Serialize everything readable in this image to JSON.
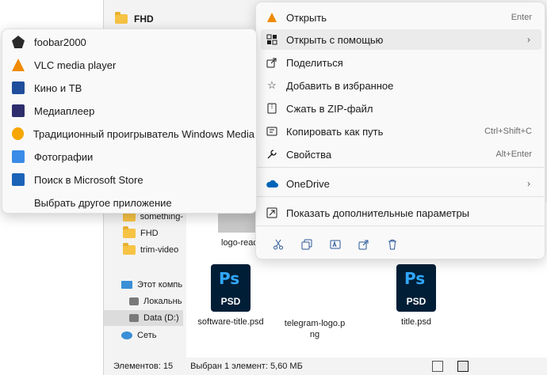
{
  "explorer": {
    "folder_title": "FHD",
    "nav_items": [
      {
        "label": "something-",
        "icon": "folder-icon"
      },
      {
        "label": "FHD",
        "icon": "folder-icon"
      },
      {
        "label": "trim-video",
        "icon": "folder-icon"
      },
      {
        "label": "Этот компь",
        "icon": "pc-icon"
      },
      {
        "label": "Локальнь",
        "icon": "drive-icon"
      },
      {
        "label": "Data (D:)",
        "icon": "drive-icon"
      },
      {
        "label": "Сеть",
        "icon": "network-icon"
      }
    ],
    "files": [
      {
        "name": "logo-ready",
        "type": "thumbnail"
      },
      {
        "name": "software-title.psd",
        "type": "psd"
      },
      {
        "name": "telegram-logo.p\nng",
        "type": "image"
      },
      {
        "name": "title.psd",
        "type": "psd"
      }
    ],
    "psd_icon": {
      "badge": "Ps",
      "ext": "PSD"
    },
    "status": {
      "count": "Элементов: 15",
      "selection": "Выбран 1 элемент: 5,60 МБ"
    }
  },
  "context_menu": {
    "items": [
      {
        "label": "Открыть",
        "shortcut": "Enter",
        "icon": "vlc-cone-icon"
      },
      {
        "label": "Открыть с помощью",
        "shortcut": "",
        "icon": "open-with-icon",
        "submenu": true
      },
      {
        "label": "Поделиться",
        "shortcut": "",
        "icon": "share-icon"
      },
      {
        "label": "Добавить в избранное",
        "shortcut": "",
        "icon": "star-icon"
      },
      {
        "label": "Сжать в ZIP-файл",
        "shortcut": "",
        "icon": "zip-icon"
      },
      {
        "label": "Копировать как путь",
        "shortcut": "Ctrl+Shift+C",
        "icon": "copy-path-icon"
      },
      {
        "label": "Свойства",
        "shortcut": "Alt+Enter",
        "icon": "wrench-icon"
      },
      {
        "label": "OneDrive",
        "shortcut": "",
        "icon": "cloud-icon",
        "submenu": true
      },
      {
        "label": "Показать дополнительные параметры",
        "shortcut": "",
        "icon": "more-options-icon"
      }
    ],
    "quick_actions": [
      "cut-icon",
      "copy-icon",
      "rename-icon",
      "share-icon",
      "delete-icon"
    ]
  },
  "submenu": {
    "items": [
      {
        "label": "foobar2000",
        "icon": "foobar-icon"
      },
      {
        "label": "VLC media player",
        "icon": "vlc-icon"
      },
      {
        "label": "Кино и ТВ",
        "icon": "movies-tv-icon"
      },
      {
        "label": "Медиаплеер",
        "icon": "media-player-icon"
      },
      {
        "label": "Традиционный проигрыватель Windows Media",
        "icon": "wmp-icon"
      },
      {
        "label": "Фотографии",
        "icon": "photos-icon"
      },
      {
        "label": "Поиск в Microsoft Store",
        "icon": "store-icon"
      },
      {
        "label": "Выбрать другое приложение",
        "icon": ""
      }
    ]
  },
  "colors": {
    "accent": "#0067c0",
    "menu_bg": "#f9f9f9",
    "hover_bg": "#ebebeb"
  }
}
